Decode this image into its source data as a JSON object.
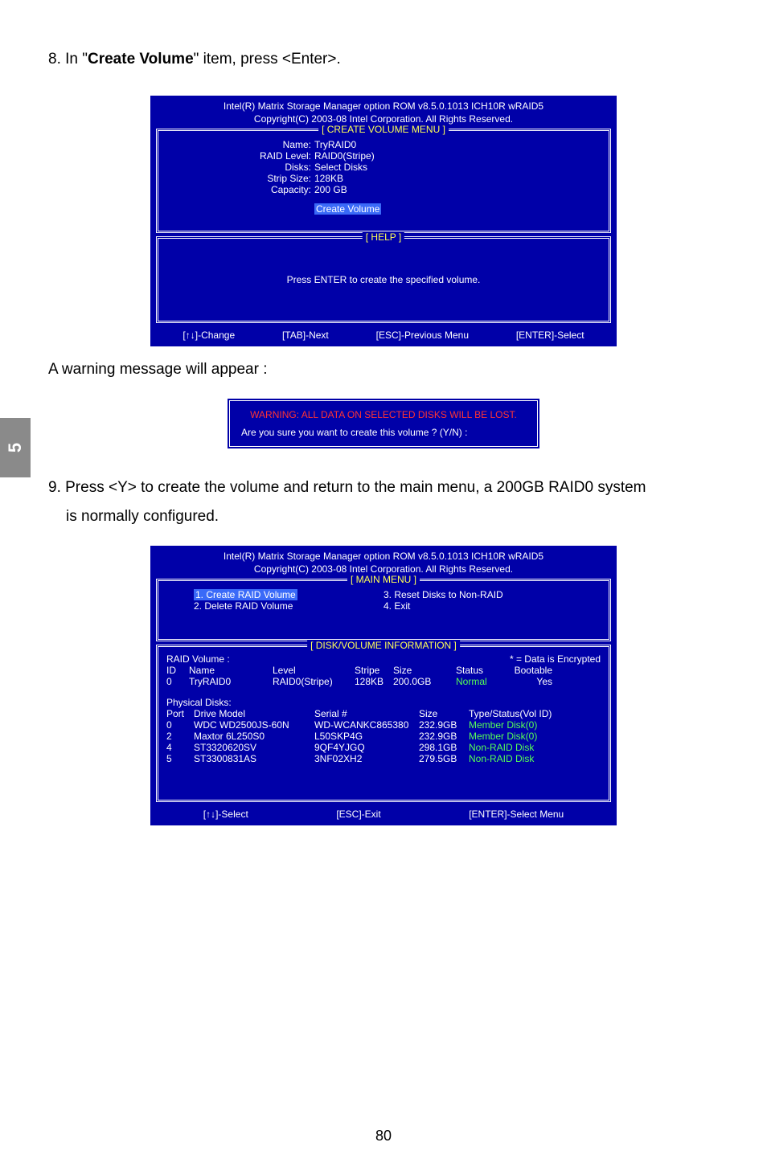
{
  "step8": {
    "prefix": "8. In \"",
    "bold": "Create Volume",
    "suffix": "\" item, press <Enter>."
  },
  "sidebar": {
    "label": "5"
  },
  "bios1": {
    "header1": "Intel(R) Matrix Storage Manager option ROM v8.5.0.1013 ICH10R wRAID5",
    "header2": "Copyright(C) 2003-08 Intel Corporation.   All Rights Reserved.",
    "frame_title": "[ CREATE VOLUME MENU ]",
    "rows": {
      "name_key": "Name:",
      "name_val": "TryRAID0",
      "level_key": "RAID Level:",
      "level_val": "RAID0(Stripe)",
      "disks_key": "Disks:",
      "disks_val": "Select Disks",
      "strip_key": "Strip Size:",
      "strip_val": "128KB",
      "cap_key": "Capacity:",
      "cap_val": "200  GB"
    },
    "create_btn": "Create Volume",
    "help_title": "[ HELP ]",
    "help_text": "Press ENTER to create the specified volume.",
    "footer": {
      "change": "[↑↓]-Change",
      "tab": "[TAB]-Next",
      "esc": "[ESC]-Previous Menu",
      "enter": "[ENTER]-Select"
    }
  },
  "warning_intro": "A warning message will appear :",
  "warning": {
    "line1": "WARNING: ALL DATA ON SELECTED DISKS WILL BE LOST.",
    "line2": "Are you sure you want to create this volume ? (Y/N) :"
  },
  "step9": {
    "line1": "9. Press <Y> to create the volume and return to the main menu, a 200GB RAID0 system",
    "line2": "is normally configured."
  },
  "bios2": {
    "header1": "Intel(R) Matrix Storage Manager option ROM v8.5.0.1013 ICH10R wRAID5",
    "header2": "Copyright(C) 2003-08 Intel Corporation.   All Rights Reserved.",
    "mainmenu_title": "[ MAIN MENU ]",
    "menu": {
      "item1": "1. Create RAID Volume",
      "item2": "2. Delete RAID Volume",
      "item3": "3. Reset Disks to Non-RAID",
      "item4": "4. Exit"
    },
    "info_title": "[ DISK/VOLUME INFORMATION ]",
    "raid_volume_label": "RAID Volume :",
    "encrypted_label": "* = Data is Encrypted",
    "raid_header": {
      "id": "ID",
      "name": "Name",
      "level": "Level",
      "stripe": "Stripe",
      "size": "Size",
      "status": "Status",
      "boot": "Bootable"
    },
    "raid_row": {
      "id": "0",
      "name": "TryRAID0",
      "level": "RAID0(Stripe)",
      "stripe": "128KB",
      "size": "200.0GB",
      "status": "Normal",
      "boot": "Yes"
    },
    "phys_label": "Physical Disks:",
    "disks_header": {
      "port": "Port",
      "model": "Drive Model",
      "serial": "Serial #",
      "size": "Size",
      "type": "Type/Status(Vol ID)"
    },
    "disks": [
      {
        "port": "0",
        "model": "WDC WD2500JS-60N",
        "serial": "WD-WCANKC865380",
        "size": "232.9GB",
        "type": "Member Disk(0)"
      },
      {
        "port": "2",
        "model": "Maxtor 6L250S0",
        "serial": "L50SKP4G",
        "size": "232.9GB",
        "type": "Member Disk(0)"
      },
      {
        "port": "4",
        "model": "ST3320620SV",
        "serial": "9QF4YJGQ",
        "size": "298.1GB",
        "type": "Non-RAID Disk"
      },
      {
        "port": "5",
        "model": "ST3300831AS",
        "serial": "3NF02XH2",
        "size": "279.5GB",
        "type": "Non-RAID Disk"
      }
    ],
    "footer": {
      "select": "[↑↓]-Select",
      "exit": "[ESC]-Exit",
      "enter": "[ENTER]-Select Menu"
    }
  },
  "page_num": "80"
}
